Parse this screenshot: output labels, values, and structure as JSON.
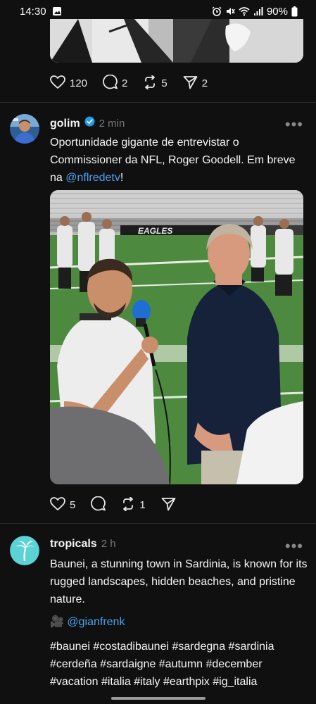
{
  "status_bar": {
    "time": "14:30",
    "battery": "90%"
  },
  "post_prev": {
    "likes": "120",
    "replies": "2",
    "reposts": "5",
    "shares": "2"
  },
  "post_golim": {
    "username": "golim",
    "time": "2 min",
    "text_before": "Oportunidade gigante de entrevistar o Commissioner da NFL, Roger Goodell. Em breve na ",
    "mention": "@nflredetv",
    "text_after": "!",
    "image_banner_text": "EAGLES",
    "likes": "5",
    "reposts": "1"
  },
  "post_tropicals": {
    "username": "tropicals",
    "time": "2 h",
    "text": "Baunei, a stunning town in Sardinia, is known for its rugged landscapes, hidden beaches, and pristine nature.",
    "credit_emoji": "🎥",
    "credit_handle": "@gianfrenk",
    "hashtags": "#baunei #costadibaunei #sardegna #sardinia #cerdeña #sardaigne #autumn #december #vacation #italia #italy #earthpix #ig_italia"
  },
  "colors": {
    "background": "#101010",
    "link": "#4aa3f0",
    "verified": "#1d9bf0",
    "muted": "#777777"
  }
}
